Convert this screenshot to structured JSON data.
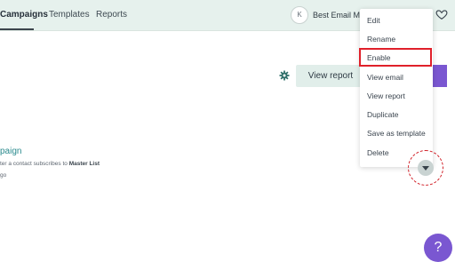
{
  "nav": {
    "tabs": [
      {
        "label": "Campaigns",
        "active": true
      },
      {
        "label": "Templates",
        "active": false
      },
      {
        "label": "Reports",
        "active": false
      }
    ]
  },
  "account": {
    "avatar_initial": "K",
    "name": "Best Email Mar"
  },
  "toolbar": {
    "view_report_label": "View report"
  },
  "campaign": {
    "title": "paign",
    "trigger_prefix": "ter a contact subscribes to ",
    "trigger_list": "Master List",
    "sub": "go"
  },
  "menu": {
    "items": [
      "Edit",
      "Rename",
      "Enable",
      "View email",
      "View report",
      "Duplicate",
      "Save as template",
      "Delete"
    ],
    "highlighted": "Enable"
  },
  "help": {
    "label": "?"
  },
  "icons": [
    "heart-icon",
    "gear-icon",
    "caret-down-icon",
    "help-icon"
  ],
  "colors": {
    "topbar": "#e6f1ed",
    "accent_purple": "#7a57d1",
    "campaign_title": "#2a8a8d",
    "annotation_red": "#e0202a"
  }
}
